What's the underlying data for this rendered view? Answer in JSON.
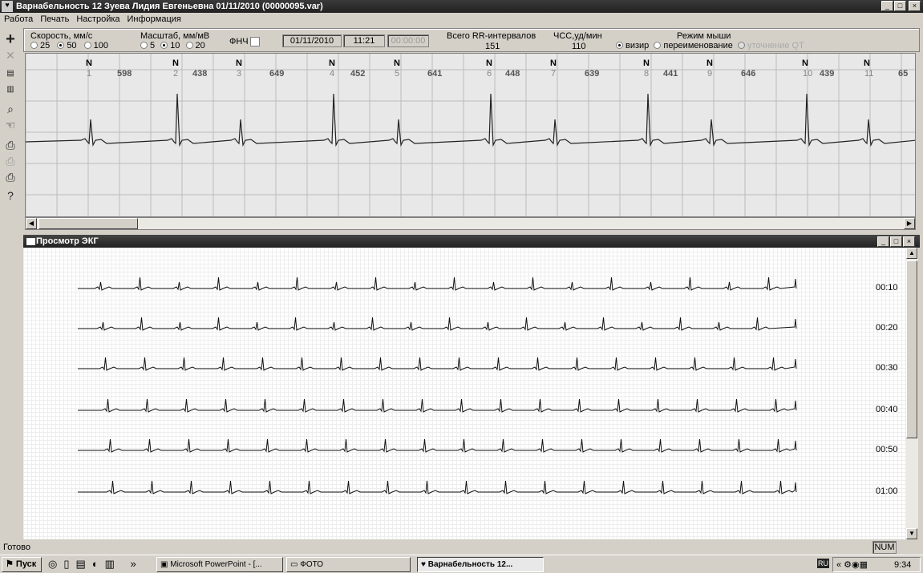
{
  "window": {
    "title": "Варнабельность   12 Зуева Лидия Евгеньевна  01/11/2010 (00000095.var)",
    "minimize": "_",
    "maximize": "□",
    "close": "×"
  },
  "menu": [
    "Работа",
    "Печать",
    "Настройка",
    "Информация"
  ],
  "controls": {
    "speed_label": "Скорость, мм/с",
    "speed_options": [
      "25",
      "50",
      "100"
    ],
    "speed_selected": "50",
    "scale_label": "Масштаб, мм/мВ",
    "scale_options": [
      "5",
      "10",
      "20"
    ],
    "scale_selected": "10",
    "lpf_label": "ФНЧ",
    "date": "01/11/2010",
    "time": "11:21",
    "time2": "00:00:00",
    "rr_total_label": "Всего RR-интервалов",
    "rr_total": "151",
    "hr_label": "ЧСС,уд/мин",
    "hr": "110",
    "mouse_mode_label": "Режим мыши",
    "mouse_modes": [
      "визир",
      "переименование",
      "уточнение QT"
    ],
    "mouse_mode_selected": "визир"
  },
  "beats": [
    {
      "type": "N",
      "index": "1"
    },
    {
      "type": "N",
      "index": "2"
    },
    {
      "type": "N",
      "index": "3"
    },
    {
      "type": "N",
      "index": "4"
    },
    {
      "type": "N",
      "index": "5"
    },
    {
      "type": "N",
      "index": "6"
    },
    {
      "type": "N",
      "index": "7"
    },
    {
      "type": "N",
      "index": "8"
    },
    {
      "type": "N",
      "index": "9"
    },
    {
      "type": "N",
      "index": "10"
    },
    {
      "type": "N",
      "index": "11"
    }
  ],
  "rr_intervals": [
    "598",
    "438",
    "649",
    "452",
    "641",
    "448",
    "639",
    "441",
    "646",
    "439",
    "65"
  ],
  "ecg_window": {
    "title": "Просмотр ЭКГ",
    "row_times": [
      "00:10",
      "00:20",
      "00:30",
      "00:40",
      "00:50",
      "01:00"
    ]
  },
  "status": {
    "text": "Готово",
    "num": "NUM"
  },
  "taskbar": {
    "start": "Пуск",
    "tasks": [
      "Microsoft PowerPoint - [...",
      "ФОТО",
      "Варнабельность    12..."
    ],
    "lang": "RU",
    "clock": "9:34"
  }
}
